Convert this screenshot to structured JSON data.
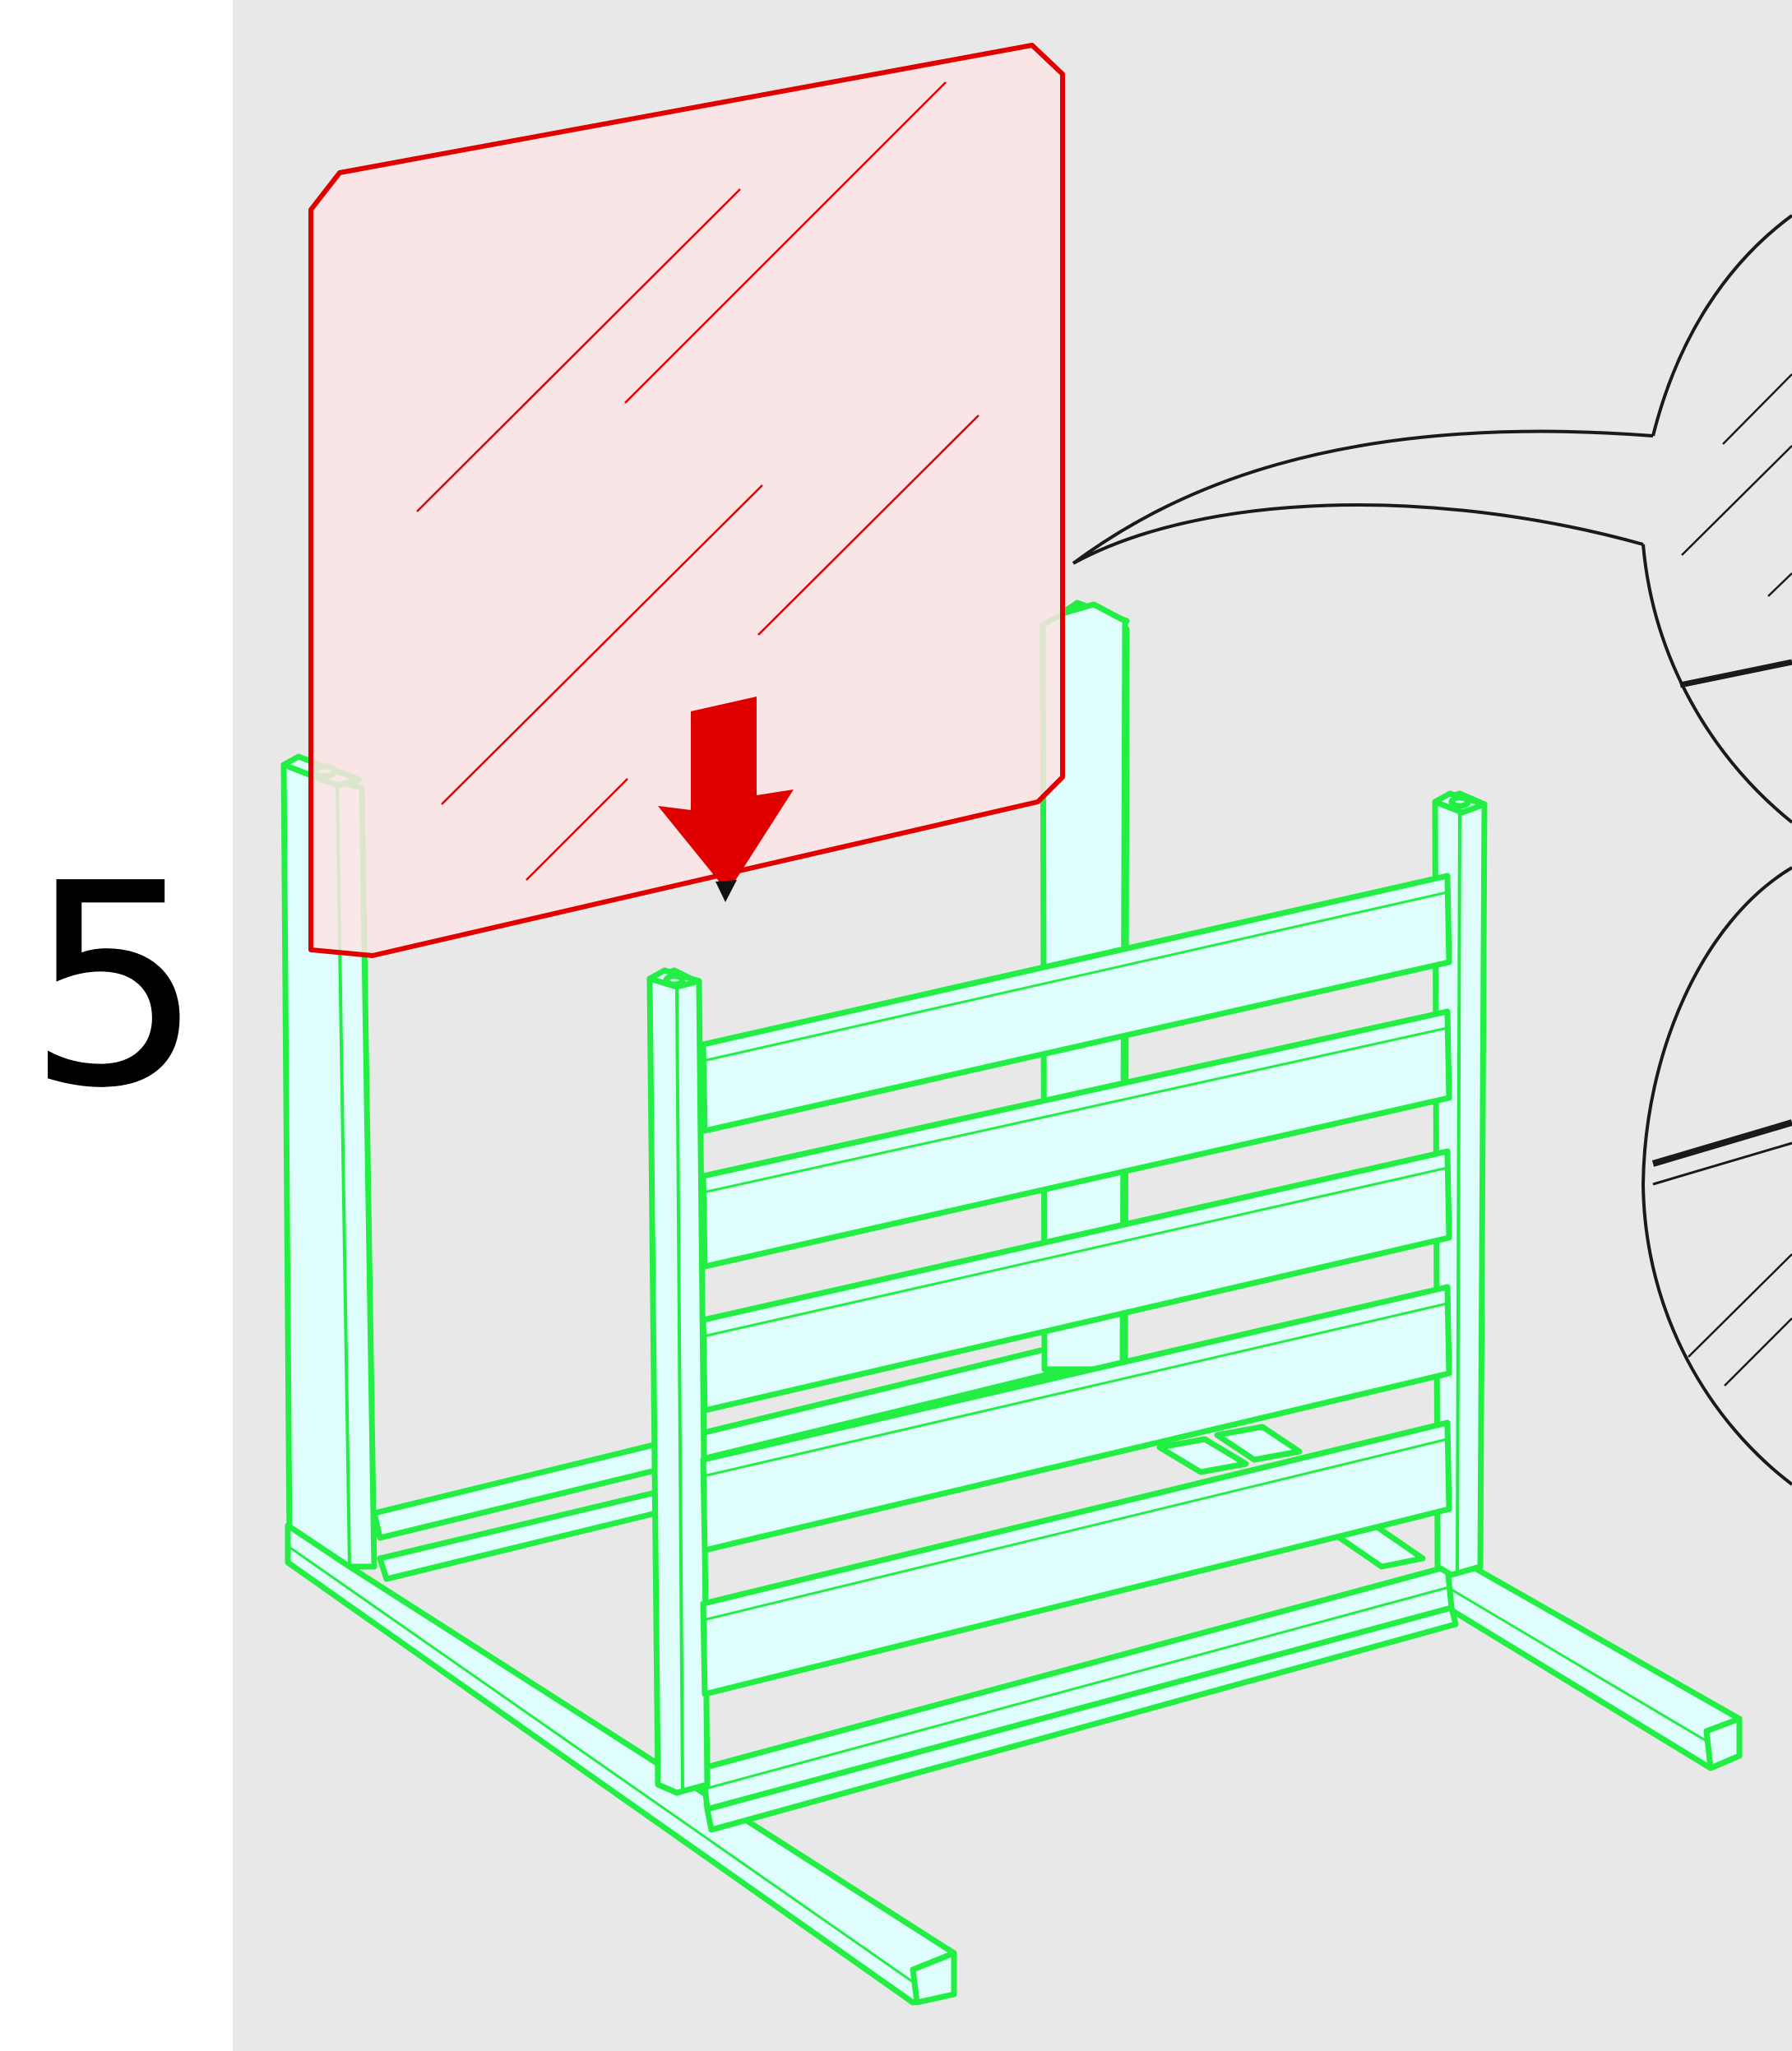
{
  "step": {
    "number": "5"
  },
  "colors": {
    "background": "#e8e8e8",
    "frame_stroke": "#22ee44",
    "frame_fill": "#e0fdfd",
    "panel_stroke": "#e00000",
    "panel_fill": "#fce4e4",
    "arrow": "#e00000",
    "callout_stroke": "#1a1a1a"
  },
  "parts": {
    "panel": "clear-acrylic-panel",
    "frame": "slatted-wooden-frame",
    "arrow": "insert-down-arrow",
    "callout": "detail-magnifier-callouts"
  }
}
